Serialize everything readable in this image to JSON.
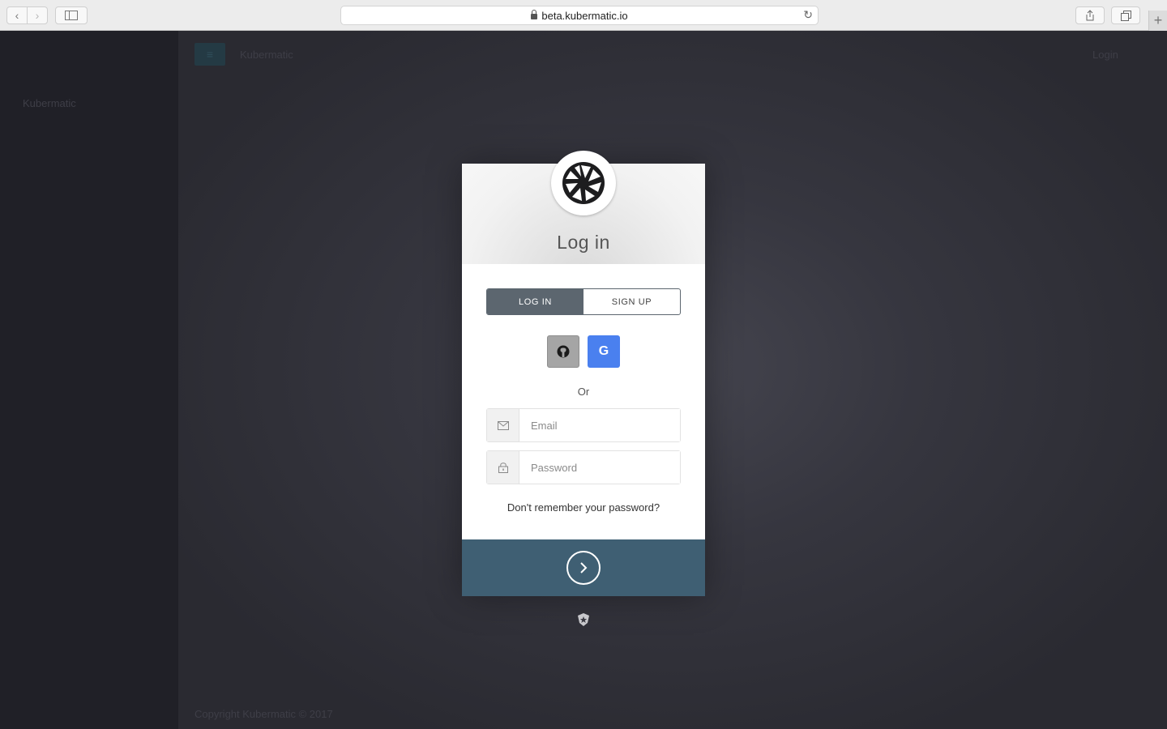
{
  "browser": {
    "url": "beta.kubermatic.io",
    "back_glyph": "‹",
    "forward_glyph": "›",
    "reload_glyph": "↻",
    "newtab_glyph": "+"
  },
  "background_app": {
    "app_name": "Kubermatic",
    "login_label": "Login",
    "nav_item": "Kubermatic",
    "footer": "Copyright Kubermatic © 2017",
    "menu_glyph": "≡"
  },
  "login_card": {
    "title": "Log in",
    "logo_icon": "aperture-icon",
    "tabs": [
      {
        "label": "LOG IN",
        "active": true
      },
      {
        "label": "SIGN UP",
        "active": false
      }
    ],
    "social": [
      {
        "icon": "github-icon"
      },
      {
        "label": "G",
        "icon": "google-icon"
      }
    ],
    "or_text": "Or",
    "email_placeholder": "Email",
    "password_placeholder": "Password",
    "forgot_text": "Don't remember your password?",
    "submit_icon": "chevron-right-icon",
    "footer_icon": "auth0-icon"
  },
  "colors": {
    "submit_bar": "#3f5f73",
    "active_tab": "#5c666f",
    "google": "#4a80ef",
    "github": "#a5a5a5"
  }
}
